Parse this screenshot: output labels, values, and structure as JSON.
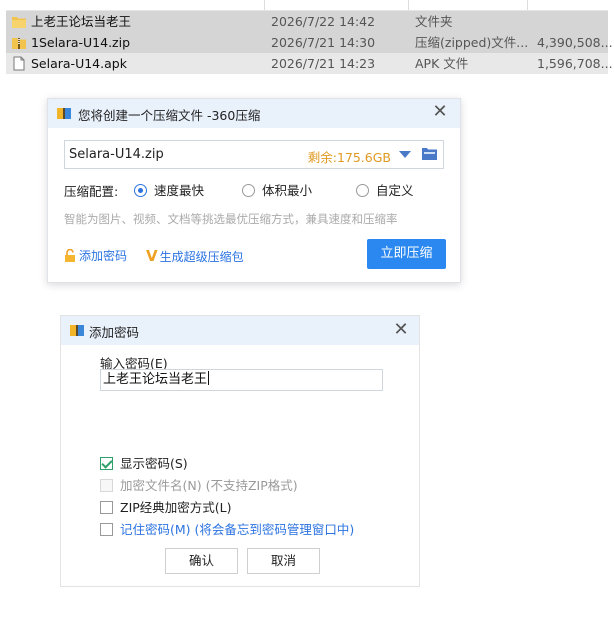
{
  "file_list": {
    "rows": [
      {
        "name": "上老王论坛当老王",
        "date": "2026/7/22 14:42",
        "type": "文件夹",
        "size": "",
        "icon": "folder-icon"
      },
      {
        "name": "1Selara-U14.zip",
        "date": "2026/7/21 14:30",
        "type": "压缩(zipped)文件...",
        "size": "4,390,508...",
        "icon": "zip-icon"
      },
      {
        "name": "Selara-U14.apk",
        "date": "2026/7/21 14:23",
        "type": "APK 文件",
        "size": "1,596,708...",
        "icon": "file-icon"
      }
    ]
  },
  "compress_dialog": {
    "title": "您将创建一个压缩文件 -360压缩",
    "filename": "Selara-U14.zip",
    "free_space": "剩余:175.6GB",
    "config_label": "压缩配置:",
    "options": [
      "速度最快",
      "体积最小",
      "自定义"
    ],
    "selected_option": "速度最快",
    "hint": "智能为图片、视频、文档等挑选最优压缩方式，兼具速度和压缩率",
    "add_password": "添加密码",
    "make_super": "生成超级压缩包",
    "compress_button": "立即压缩",
    "colors": {
      "accent": "#2b88f0",
      "free_space": "#e09a22"
    }
  },
  "password_dialog": {
    "title": "添加密码",
    "input_label": "输入密码(E)",
    "input_value": "上老王论坛当老王",
    "options": [
      {
        "label": "显示密码(S)",
        "note": "",
        "checked": true,
        "enabled": true
      },
      {
        "label": "加密文件名(N)",
        "note": "(不支持ZIP格式)",
        "checked": false,
        "enabled": false
      },
      {
        "label": "ZIP经典加密方式(L)",
        "note": "",
        "checked": false,
        "enabled": true
      },
      {
        "label": "记住密码(M)",
        "note": "(将会备忘到密码管理窗口中)",
        "checked": false,
        "enabled": true
      }
    ],
    "ok_button": "确认",
    "cancel_button": "取消"
  }
}
